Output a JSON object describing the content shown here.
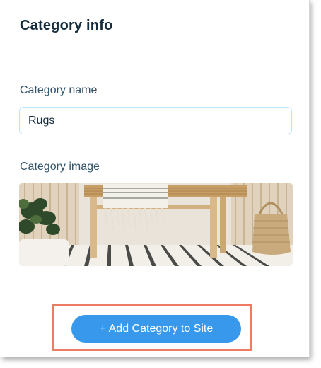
{
  "panel": {
    "title": "Category info"
  },
  "form": {
    "name_label": "Category name",
    "name_value": "Rugs",
    "image_label": "Category image"
  },
  "footer": {
    "add_button_label": "+ Add Category to Site"
  },
  "colors": {
    "accent": "#3899ec",
    "title_text": "#162d3d",
    "label_text": "#32536a",
    "highlight": "#ec7b63"
  }
}
